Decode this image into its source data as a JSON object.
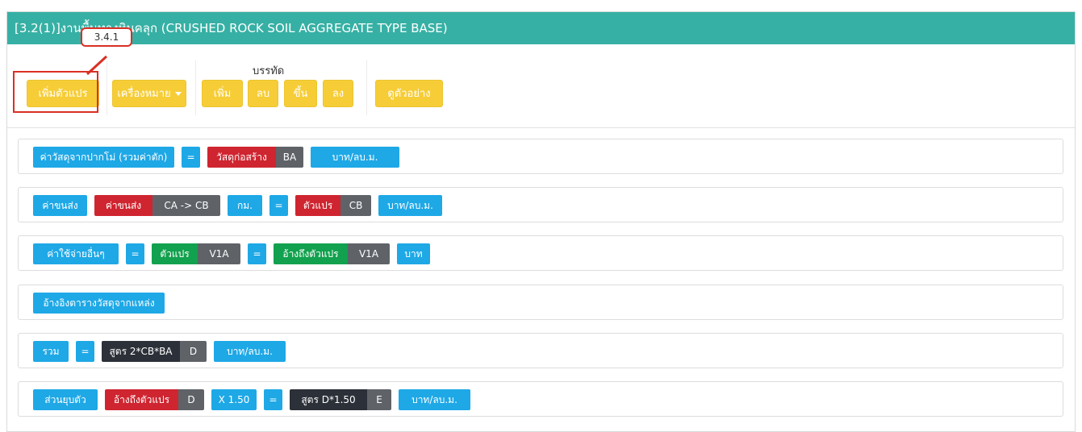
{
  "panel": {
    "title": "[3.2(1)]งานพื้นทางหินคลุก (CRUSHED ROCK SOIL AGGREGATE TYPE BASE)"
  },
  "toolbar": {
    "callout_label": "3.4.1",
    "add_variable": "เพิ่มตัวแปร",
    "tools": "เครื่องหมาย",
    "row_group_title": "บรรทัด",
    "row_add": "เพิ่ม",
    "row_delete": "ลบ",
    "row_up": "ขึ้น",
    "row_down": "ลง",
    "preview": "ดูตัวอย่าง"
  },
  "rows": [
    {
      "items": [
        {
          "text": "ค่าวัสดุจากปากโม่ (รวมค่าตัก)",
          "color": "blue"
        },
        {
          "text": "=",
          "color": "blue"
        },
        {
          "text": "วัสดุก่อสร้าง",
          "color": "red",
          "code": "BA"
        },
        {
          "text": "บาท/ลบ.ม.",
          "color": "blue"
        }
      ]
    },
    {
      "items": [
        {
          "text": "ค่าขนส่ง",
          "color": "blue"
        },
        {
          "text": "ค่าขนส่ง",
          "color": "red",
          "code": "CA -> CB"
        },
        {
          "text": "กม.",
          "color": "blue"
        },
        {
          "text": "=",
          "color": "blue"
        },
        {
          "text": "ตัวแปร",
          "color": "red",
          "code": "CB"
        },
        {
          "text": "บาท/ลบ.ม.",
          "color": "blue"
        }
      ]
    },
    {
      "items": [
        {
          "text": "ค่าใช้จ่ายอื่นๆ",
          "color": "blue"
        },
        {
          "text": "=",
          "color": "blue"
        },
        {
          "text": "ตัวแปร",
          "color": "green",
          "code": "V1A"
        },
        {
          "text": "=",
          "color": "blue"
        },
        {
          "text": "อ้างถึงตัวแปร",
          "color": "green",
          "code": "V1A"
        },
        {
          "text": "บาท",
          "color": "blue"
        }
      ]
    },
    {
      "items": [
        {
          "text": "อ้างอิงตารางวัสดุจากแหล่ง",
          "color": "blue"
        }
      ]
    },
    {
      "items": [
        {
          "text": "รวม",
          "color": "blue"
        },
        {
          "text": "=",
          "color": "blue"
        },
        {
          "text": "สูตร 2*CB*BA",
          "color": "dark",
          "code": "D"
        },
        {
          "text": "บาท/ลบ.ม.",
          "color": "blue"
        }
      ]
    },
    {
      "items": [
        {
          "text": "ส่วนยุบตัว",
          "color": "blue"
        },
        {
          "text": "อ้างถึงตัวแปร",
          "color": "red",
          "code": "D"
        },
        {
          "text": "X 1.50",
          "color": "blue"
        },
        {
          "text": "=",
          "color": "blue"
        },
        {
          "text": "สูตร D*1.50",
          "color": "dark",
          "code": "E"
        },
        {
          "text": "บาท/ลบ.ม.",
          "color": "blue"
        }
      ]
    }
  ],
  "colors": {
    "header": "#36b0a4",
    "button_yellow": "#f6cd37",
    "chip_blue": "#1ea8e6",
    "chip_red": "#cf2530",
    "chip_green": "#12a14e",
    "chip_dark": "#2c3038",
    "chip_gray": "#5f6368",
    "annotation_red": "#d93025"
  }
}
